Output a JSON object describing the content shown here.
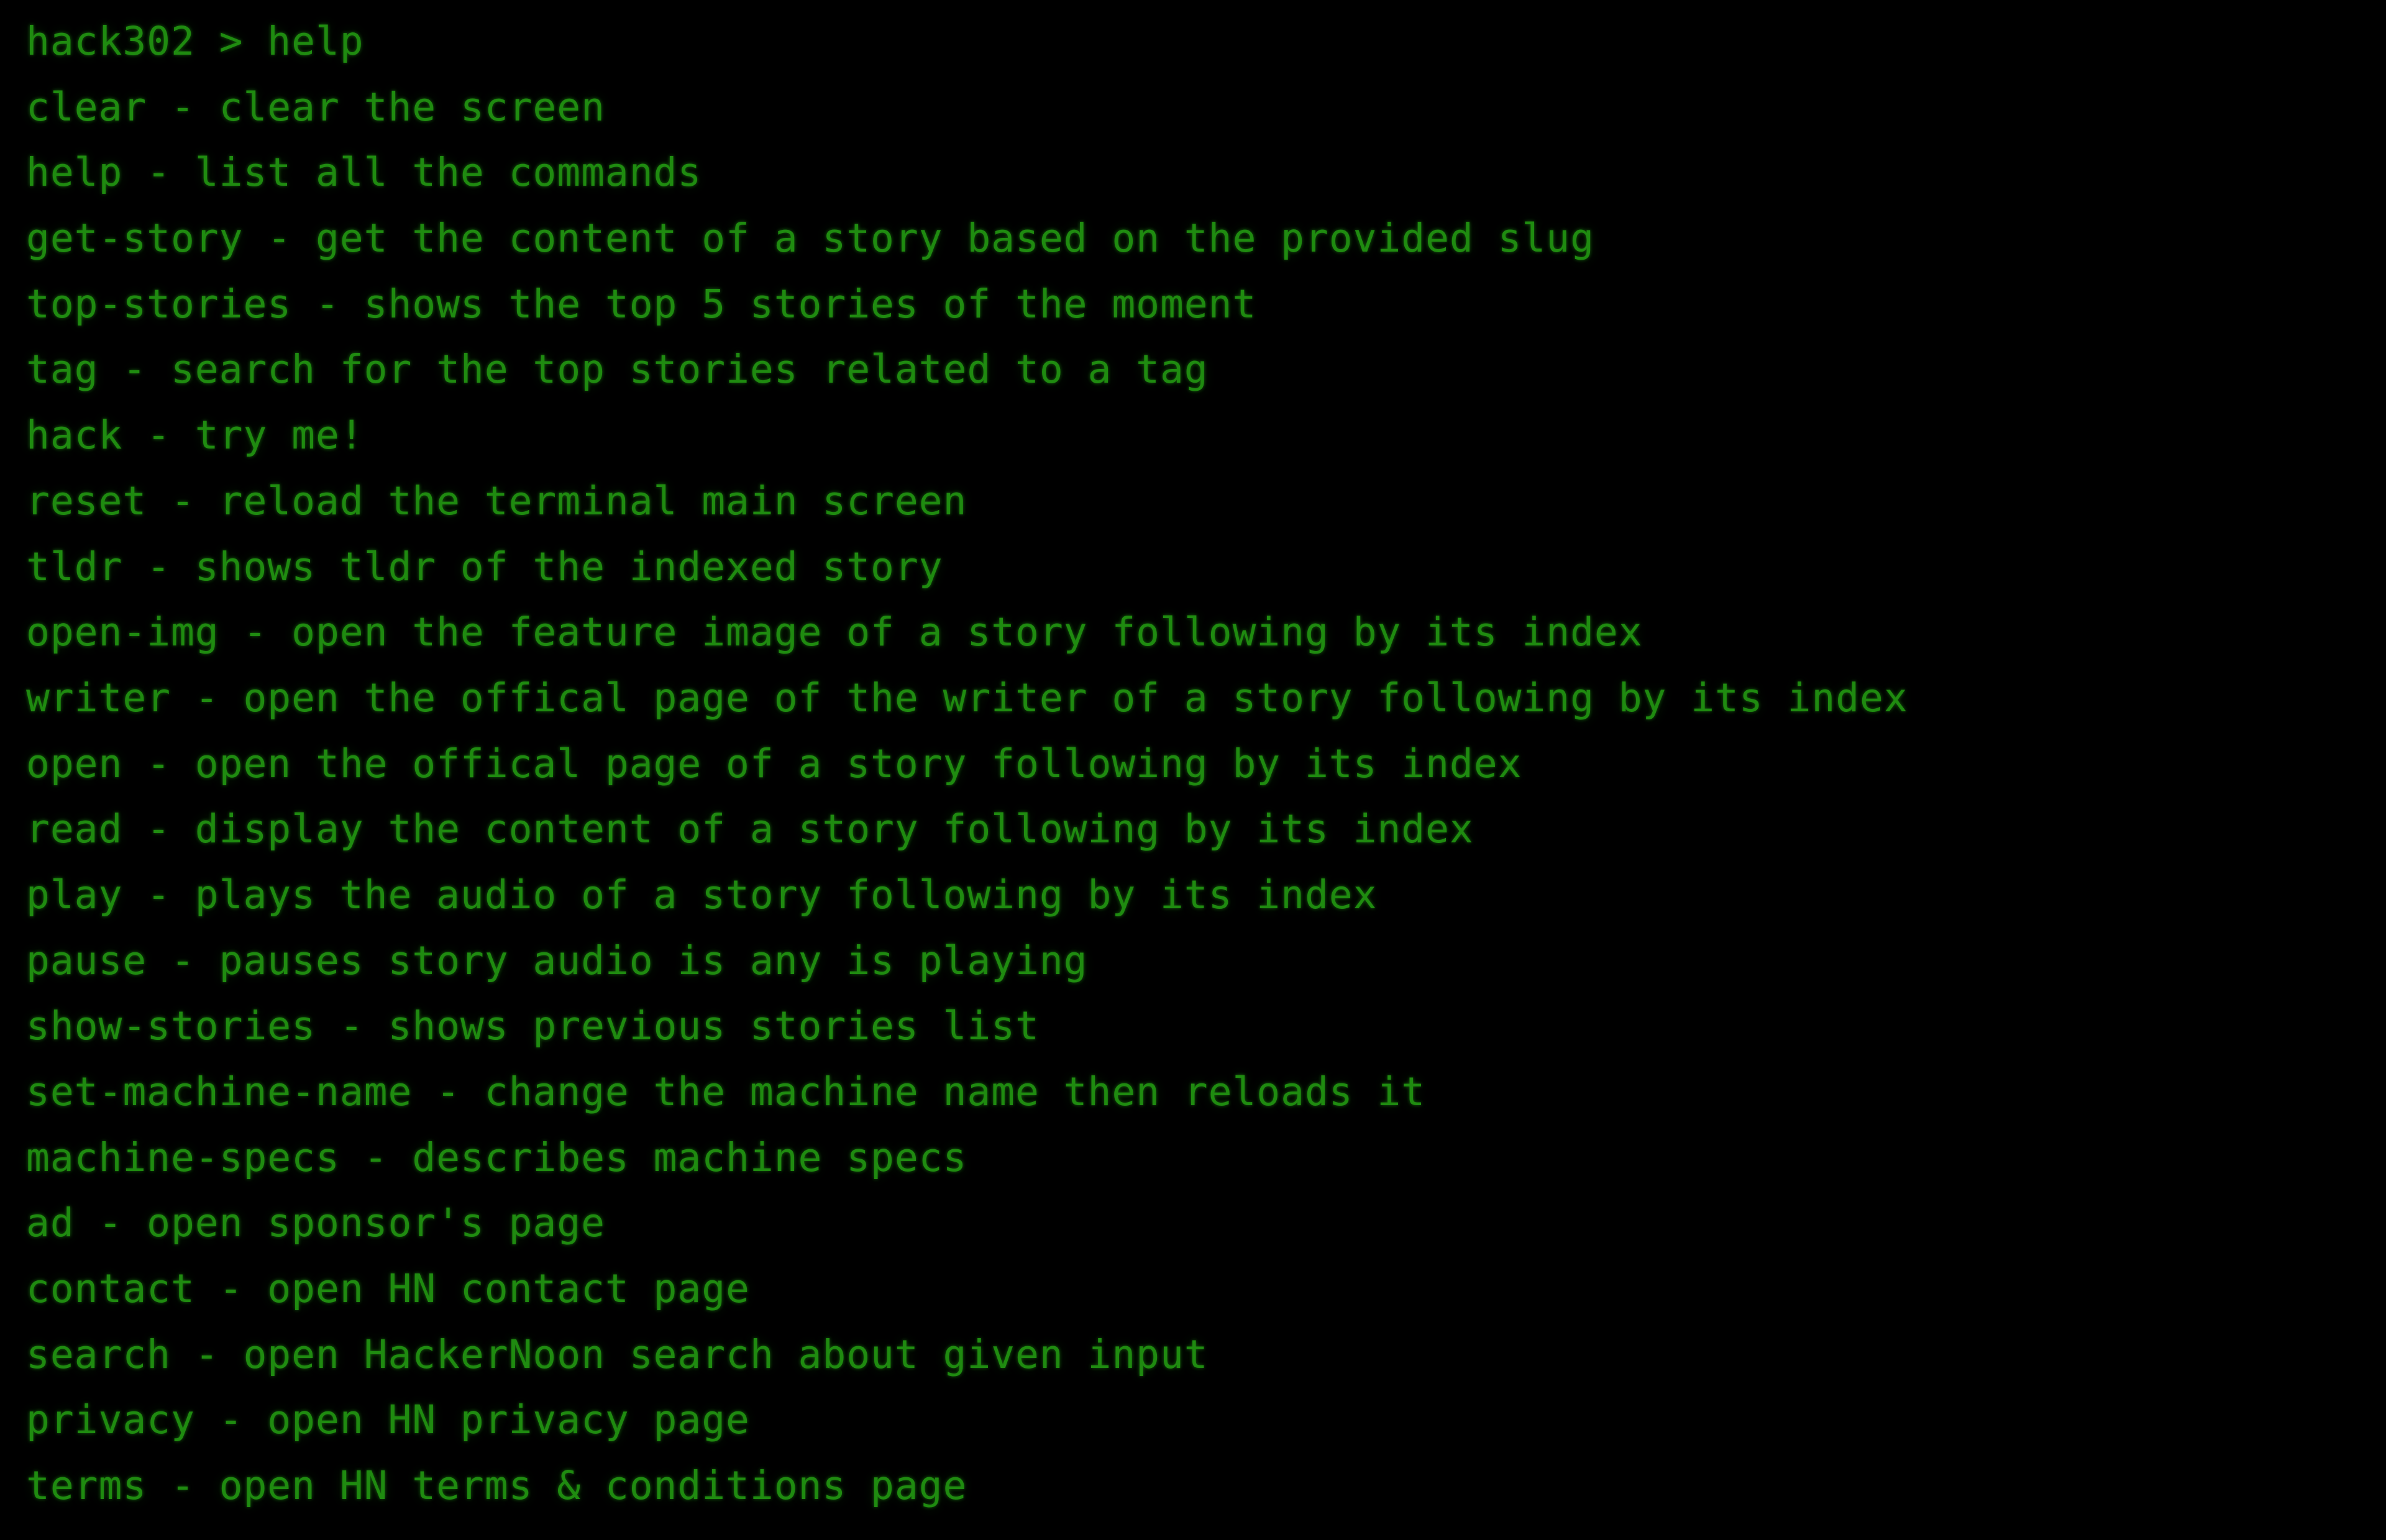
{
  "terminal": {
    "machine_name": "hack302",
    "prompt_symbol": ">",
    "entered_command": "help",
    "prompt_line": "hack302 > help",
    "accent_color": "#1f8b10",
    "background_color": "#000000",
    "lines": [
      {
        "id": "prompt",
        "text": "hack302 > help",
        "kind": "prompt"
      },
      {
        "id": "clear",
        "text": "clear - clear the screen",
        "kind": "help-entry"
      },
      {
        "id": "help",
        "text": "help - list all the commands",
        "kind": "help-entry"
      },
      {
        "id": "get-story",
        "text": "get-story - get the content of a story based on the provided slug",
        "kind": "help-entry"
      },
      {
        "id": "top-stories",
        "text": "top-stories - shows the top 5 stories of the moment",
        "kind": "help-entry"
      },
      {
        "id": "tag",
        "text": "tag - search for the top stories related to a tag",
        "kind": "help-entry"
      },
      {
        "id": "hack",
        "text": "hack - try me!",
        "kind": "help-entry"
      },
      {
        "id": "reset",
        "text": "reset - reload the terminal main screen",
        "kind": "help-entry"
      },
      {
        "id": "tldr",
        "text": "tldr - shows tldr of the indexed story",
        "kind": "help-entry"
      },
      {
        "id": "open-img",
        "text": "open-img - open the feature image of a story following by its index",
        "kind": "help-entry"
      },
      {
        "id": "writer",
        "text": "writer - open the offical page of the writer of a story following by its index",
        "kind": "help-entry"
      },
      {
        "id": "open",
        "text": "open - open the offical page of a story following by its index",
        "kind": "help-entry"
      },
      {
        "id": "read",
        "text": "read - display the content of a story following by its index",
        "kind": "help-entry"
      },
      {
        "id": "play",
        "text": "play - plays the audio of a story following by its index",
        "kind": "help-entry"
      },
      {
        "id": "pause",
        "text": "pause - pauses story audio is any is playing",
        "kind": "help-entry"
      },
      {
        "id": "show-stories",
        "text": "show-stories - shows previous stories list",
        "kind": "help-entry"
      },
      {
        "id": "set-machine-name",
        "text": "set-machine-name - change the machine name then reloads it",
        "kind": "help-entry"
      },
      {
        "id": "machine-specs",
        "text": "machine-specs - describes machine specs",
        "kind": "help-entry"
      },
      {
        "id": "ad",
        "text": "ad - open sponsor's page",
        "kind": "help-entry"
      },
      {
        "id": "contact",
        "text": "contact - open HN contact page",
        "kind": "help-entry"
      },
      {
        "id": "search",
        "text": "search - open HackerNoon search about given input",
        "kind": "help-entry"
      },
      {
        "id": "privacy",
        "text": "privacy - open HN privacy page",
        "kind": "help-entry"
      },
      {
        "id": "terms",
        "text": "terms - open HN terms & conditions page",
        "kind": "help-entry"
      }
    ]
  }
}
